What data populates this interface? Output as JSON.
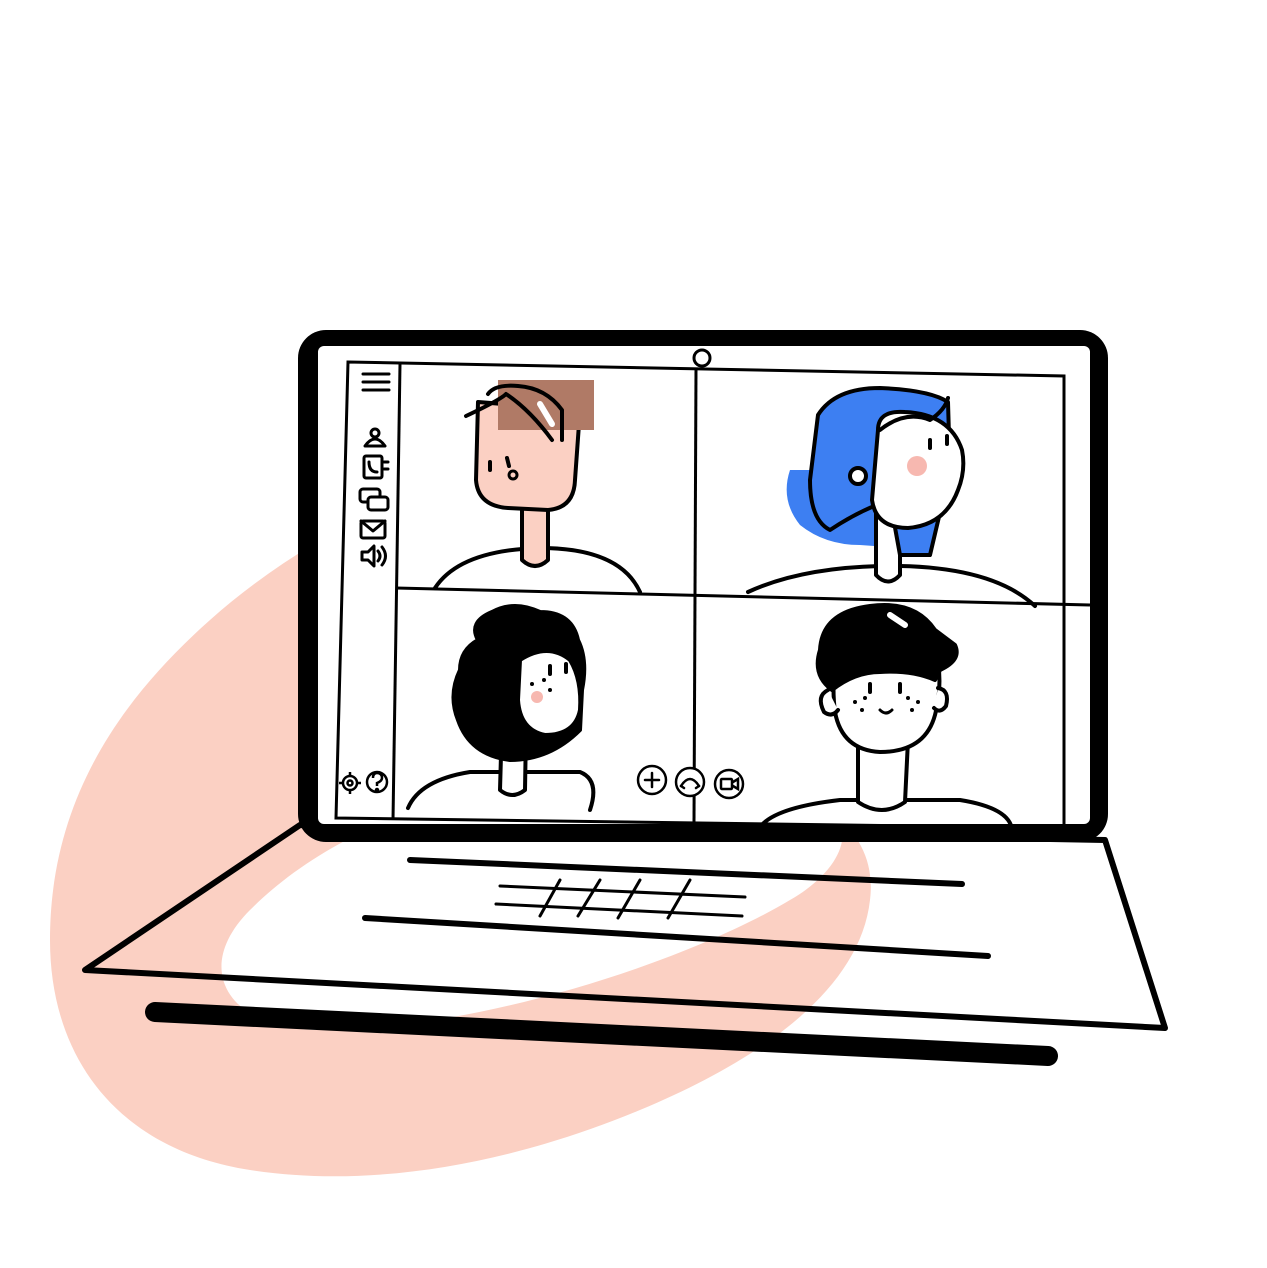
{
  "colors": {
    "background": "#ffffff",
    "blob": "#fbd0c3",
    "outline": "#000000",
    "screen": "#ffffff",
    "skin": "#fbd0c3",
    "hair_brown": "#b07a66",
    "hair_blue": "#3d7ff2",
    "hair_black": "#000000",
    "blush": "#f7b8b0"
  },
  "sidebar": {
    "items": [
      {
        "icon": "menu-icon"
      },
      {
        "icon": "contact-icon"
      },
      {
        "icon": "phonebook-icon"
      },
      {
        "icon": "chat-icon"
      },
      {
        "icon": "mail-icon"
      },
      {
        "icon": "speaker-icon"
      }
    ],
    "footer": [
      {
        "icon": "gear-icon"
      },
      {
        "icon": "help-icon"
      }
    ]
  },
  "call_controls": [
    {
      "icon": "add-icon"
    },
    {
      "icon": "hang-up-icon"
    },
    {
      "icon": "camera-icon"
    }
  ],
  "participants": [
    {
      "hair": "brown",
      "skin": "light"
    },
    {
      "hair": "blue",
      "skin": "white"
    },
    {
      "hair": "black",
      "skin": "white"
    },
    {
      "hair": "black",
      "skin": "white"
    }
  ]
}
